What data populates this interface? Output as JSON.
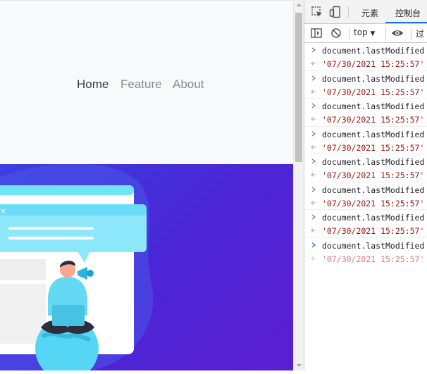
{
  "nav": {
    "links": [
      {
        "label": "Home"
      },
      {
        "label": "Feature"
      },
      {
        "label": "About"
      }
    ]
  },
  "devtools": {
    "tabs": {
      "elements": "元素",
      "console": "控制台"
    },
    "toolbar": {
      "context": "top",
      "filter_placeholder": "过"
    },
    "entries": [
      {
        "command": "document.lastModified",
        "result": "'07/30/2021 15:25:57'"
      },
      {
        "command": "document.lastModified",
        "result": "'07/30/2021 15:25:57'"
      },
      {
        "command": "document.lastModified",
        "result": "'07/30/2021 15:25:57'"
      },
      {
        "command": "document.lastModified",
        "result": "'07/30/2021 15:25:57'"
      },
      {
        "command": "document.lastModified",
        "result": "'07/30/2021 15:25:57'"
      },
      {
        "command": "document.lastModified",
        "result": "'07/30/2021 15:25:57'"
      },
      {
        "command": "document.lastModified",
        "result": "'07/30/2021 15:25:57'"
      }
    ],
    "prompt": {
      "command": "document.lastModified",
      "preview": "'07/30/2021 15:25:57'"
    }
  },
  "colors": {
    "accent": "#1a73e8",
    "hero_start": "#3b3fe0",
    "hero_end": "#5a1fd0",
    "string": "#a31515"
  }
}
